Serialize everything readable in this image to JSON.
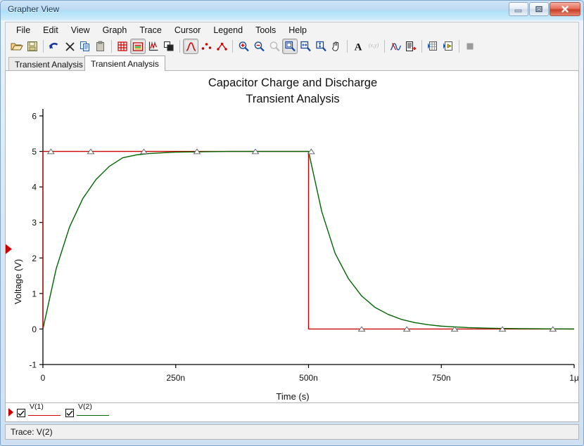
{
  "window": {
    "title": "Grapher View",
    "controls": [
      {
        "name": "minimize-button",
        "glyph": "minimize"
      },
      {
        "name": "restore-button",
        "glyph": "restore"
      },
      {
        "name": "close-button",
        "glyph": "close"
      }
    ]
  },
  "menu": {
    "items": [
      "File",
      "Edit",
      "View",
      "Graph",
      "Trace",
      "Cursor",
      "Legend",
      "Tools",
      "Help"
    ]
  },
  "toolbar": {
    "groups": [
      [
        "open-folder-icon",
        "save-icon"
      ],
      [
        "undo-icon",
        "delete-icon",
        "copy-icon",
        "paste-icon"
      ],
      [
        "grid-icon",
        "legend-icon",
        "axis-icon",
        "overlay-icon"
      ],
      [
        "curve-style-icon",
        "points-style-icon",
        "points-line-style-icon"
      ],
      [
        "zoom-in-icon",
        "zoom-out-icon",
        "zoom-restore-icon",
        "zoom-region-icon",
        "zoom-horizontal-icon",
        "zoom-vertical-icon",
        "pan-hand-icon"
      ],
      [
        "text-properties-icon",
        "coordinates-icon"
      ],
      [
        "cursor-icon",
        "properties-icon"
      ],
      [
        "export-grid-icon",
        "export-file-icon"
      ],
      [
        "stop-icon"
      ]
    ]
  },
  "tabs": [
    {
      "label": "Transient Analysis",
      "active": false
    },
    {
      "label": "Transient Analysis",
      "active": true
    }
  ],
  "statusbar": {
    "text": "Trace: V(2)"
  },
  "legend": {
    "entries": [
      {
        "label": "V(1)",
        "color": "#cc0000",
        "checked": true,
        "selected": true
      },
      {
        "label": "V(2)",
        "color": "#006600",
        "checked": true,
        "selected": false
      }
    ]
  },
  "chart_data": {
    "type": "line",
    "title": "Capacitor Charge and Discharge",
    "subtitle": "Transient Analysis",
    "xlabel": "Time (s)",
    "ylabel": "Voltage (V)",
    "xlim": [
      0,
      1e-06
    ],
    "ylim": [
      -1,
      6
    ],
    "xticks": [
      0,
      2.5e-07,
      5e-07,
      7.5e-07,
      1e-06
    ],
    "xtick_labels": [
      "0",
      "250n",
      "500n",
      "750n",
      "1µ"
    ],
    "yticks": [
      -1,
      0,
      1,
      2,
      3,
      4,
      5,
      6
    ],
    "ytick_labels": [
      "-1",
      "0",
      "1",
      "2",
      "3",
      "4",
      "5",
      "6"
    ],
    "grid": false,
    "legend_position": "bottom-left",
    "series": [
      {
        "name": "V(1)",
        "color": "#cc0000",
        "marker": "triangle",
        "description": "Input square pulse: 5 V from 0 to 500 ns, then 0 V to 1 µs",
        "x": [
          0,
          0,
          5e-08,
          1e-07,
          1.5e-07,
          2e-07,
          2.5e-07,
          3e-07,
          3.5e-07,
          4e-07,
          4.5e-07,
          5e-07,
          5e-07,
          5.5e-07,
          6e-07,
          6.5e-07,
          7e-07,
          7.5e-07,
          8e-07,
          8.5e-07,
          9e-07,
          9.5e-07,
          1e-06
        ],
        "y": [
          0,
          5,
          5,
          5,
          5,
          5,
          5,
          5,
          5,
          5,
          5,
          5,
          0,
          0,
          0,
          0,
          0,
          0,
          0,
          0,
          0,
          0,
          0
        ],
        "marker_x": [
          1.5e-08,
          9e-08,
          1.9e-07,
          2.9e-07,
          4e-07,
          5.05e-07,
          6e-07,
          6.85e-07,
          7.75e-07,
          8.65e-07,
          9.6e-07
        ],
        "marker_y": [
          5,
          5,
          5,
          5,
          5,
          5,
          0,
          0,
          0,
          0,
          0
        ]
      },
      {
        "name": "V(2)",
        "color": "#006600",
        "marker": "none",
        "description": "Capacitor voltage: exponential charge with tau ≈ 60 ns to 5 V, then exponential discharge after 500 ns",
        "x": [
          0,
          2.5e-08,
          5e-08,
          7.5e-08,
          1e-07,
          1.25e-07,
          1.5e-07,
          1.75e-07,
          2e-07,
          2.25e-07,
          2.5e-07,
          3e-07,
          3.5e-07,
          4e-07,
          4.5e-07,
          5e-07,
          5.25e-07,
          5.5e-07,
          5.75e-07,
          6e-07,
          6.25e-07,
          6.5e-07,
          6.75e-07,
          7e-07,
          7.25e-07,
          7.5e-07,
          8e-07,
          8.5e-07,
          9e-07,
          9.5e-07,
          1e-06
        ],
        "y": [
          0,
          1.7,
          2.87,
          3.67,
          4.21,
          4.58,
          4.82,
          4.9,
          4.94,
          4.96,
          4.98,
          4.99,
          5.0,
          5.0,
          5.0,
          5.0,
          3.3,
          2.13,
          1.42,
          0.93,
          0.61,
          0.41,
          0.27,
          0.18,
          0.12,
          0.08,
          0.04,
          0.02,
          0.01,
          0.005,
          0.0
        ]
      }
    ],
    "cursor_marker": {
      "axis": "y",
      "value": 2.25,
      "color": "#cc0000"
    }
  }
}
